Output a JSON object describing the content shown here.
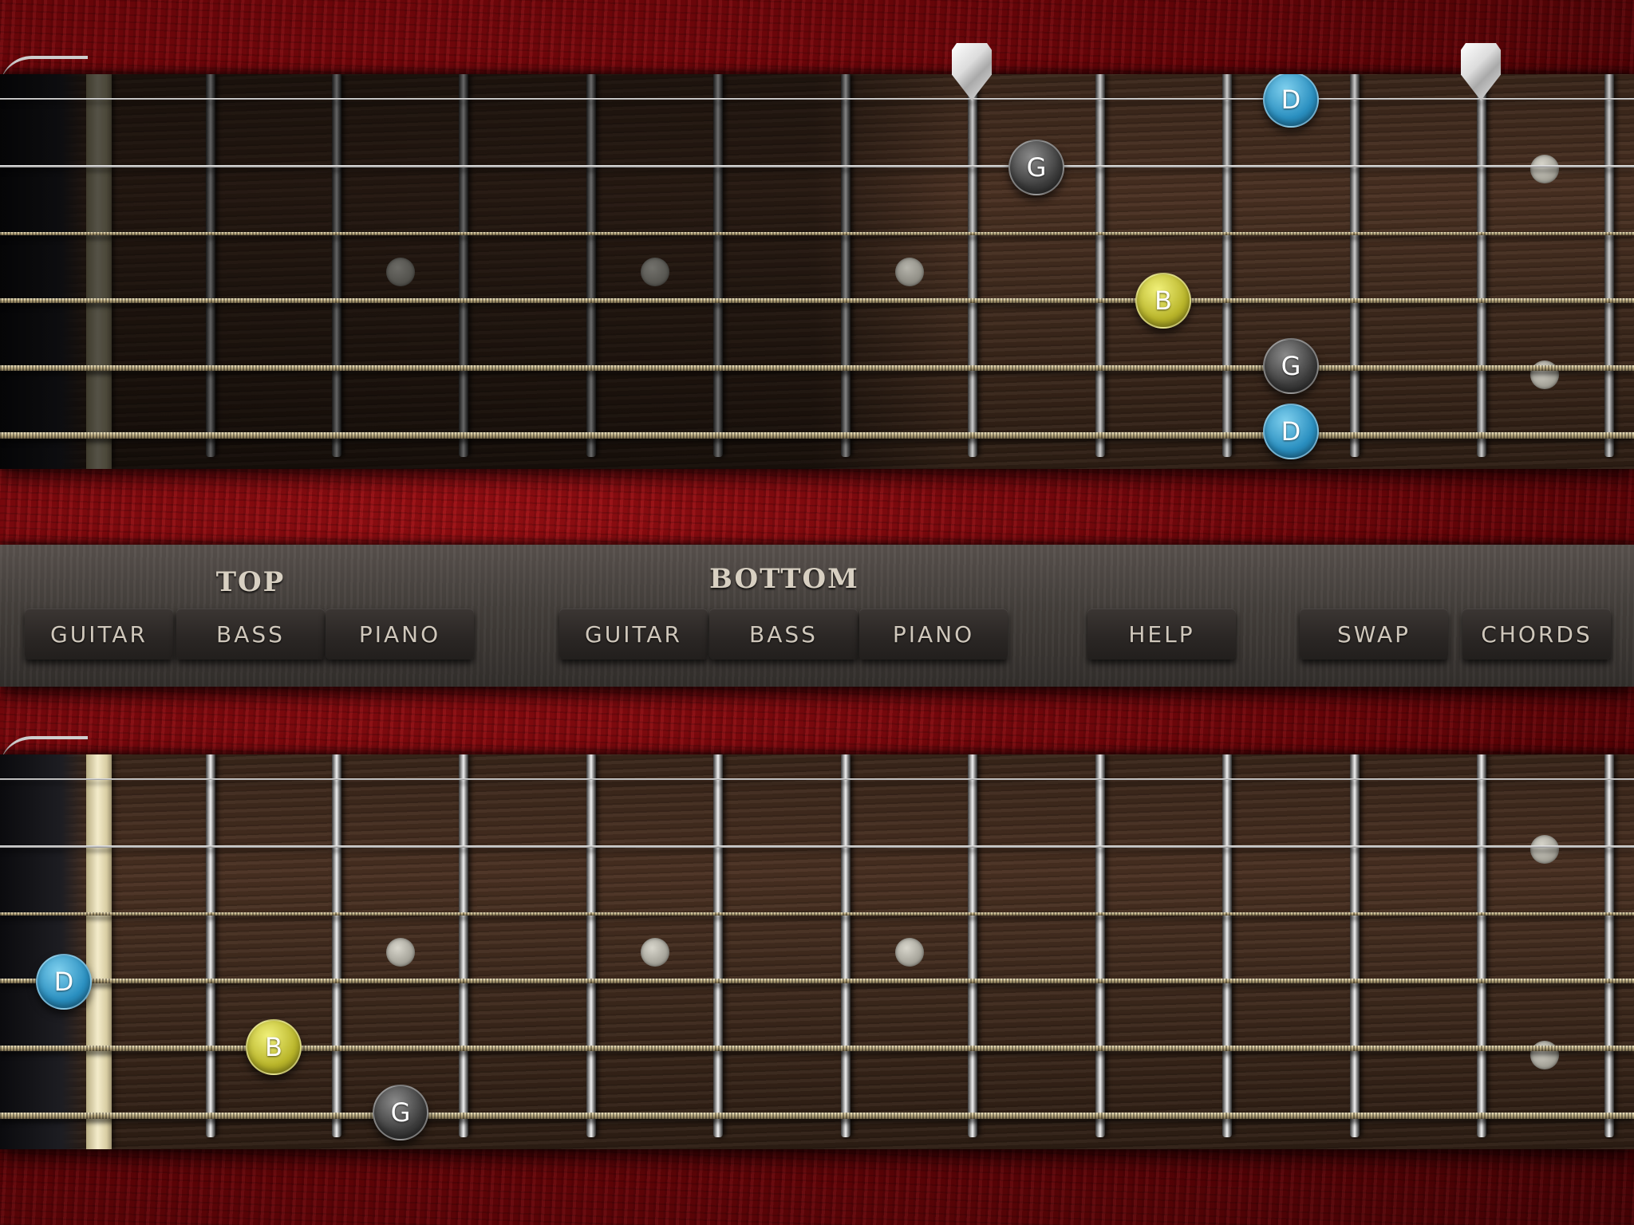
{
  "colors": {
    "background_red": "#7a070c",
    "note_D": "#2a8fc0",
    "note_B": "#b9b52a",
    "note_G": "#3d3d3d",
    "bar": "#45403c",
    "button_text": "#cfc7bb"
  },
  "top_fretboard": {
    "notes": [
      {
        "label": "D",
        "string": 1,
        "fret": 10,
        "color": "blue"
      },
      {
        "label": "G",
        "string": 2,
        "fret": 7,
        "color": "dark"
      },
      {
        "label": "B",
        "string": 4,
        "fret": 9,
        "color": "yellow"
      },
      {
        "label": "G",
        "string": 5,
        "fret": 10,
        "color": "dark"
      },
      {
        "label": "D",
        "string": 6,
        "fret": 10,
        "color": "blue"
      }
    ],
    "capo_markers": [
      "fret-7",
      "fret-11"
    ]
  },
  "bottom_fretboard": {
    "notes": [
      {
        "label": "D",
        "string": 4,
        "fret": 0,
        "color": "blue"
      },
      {
        "label": "B",
        "string": 5,
        "fret": 1,
        "color": "yellow"
      },
      {
        "label": "G",
        "string": 6,
        "fret": 2,
        "color": "dark"
      }
    ]
  },
  "controls": {
    "top": {
      "title": "TOP",
      "buttons": [
        "GUITAR",
        "BASS",
        "PIANO"
      ]
    },
    "bottom": {
      "title": "BOTTOM",
      "buttons": [
        "GUITAR",
        "BASS",
        "PIANO"
      ]
    },
    "help_label": "HELP",
    "swap_label": "SWAP",
    "chords_label": "CHORDS"
  }
}
